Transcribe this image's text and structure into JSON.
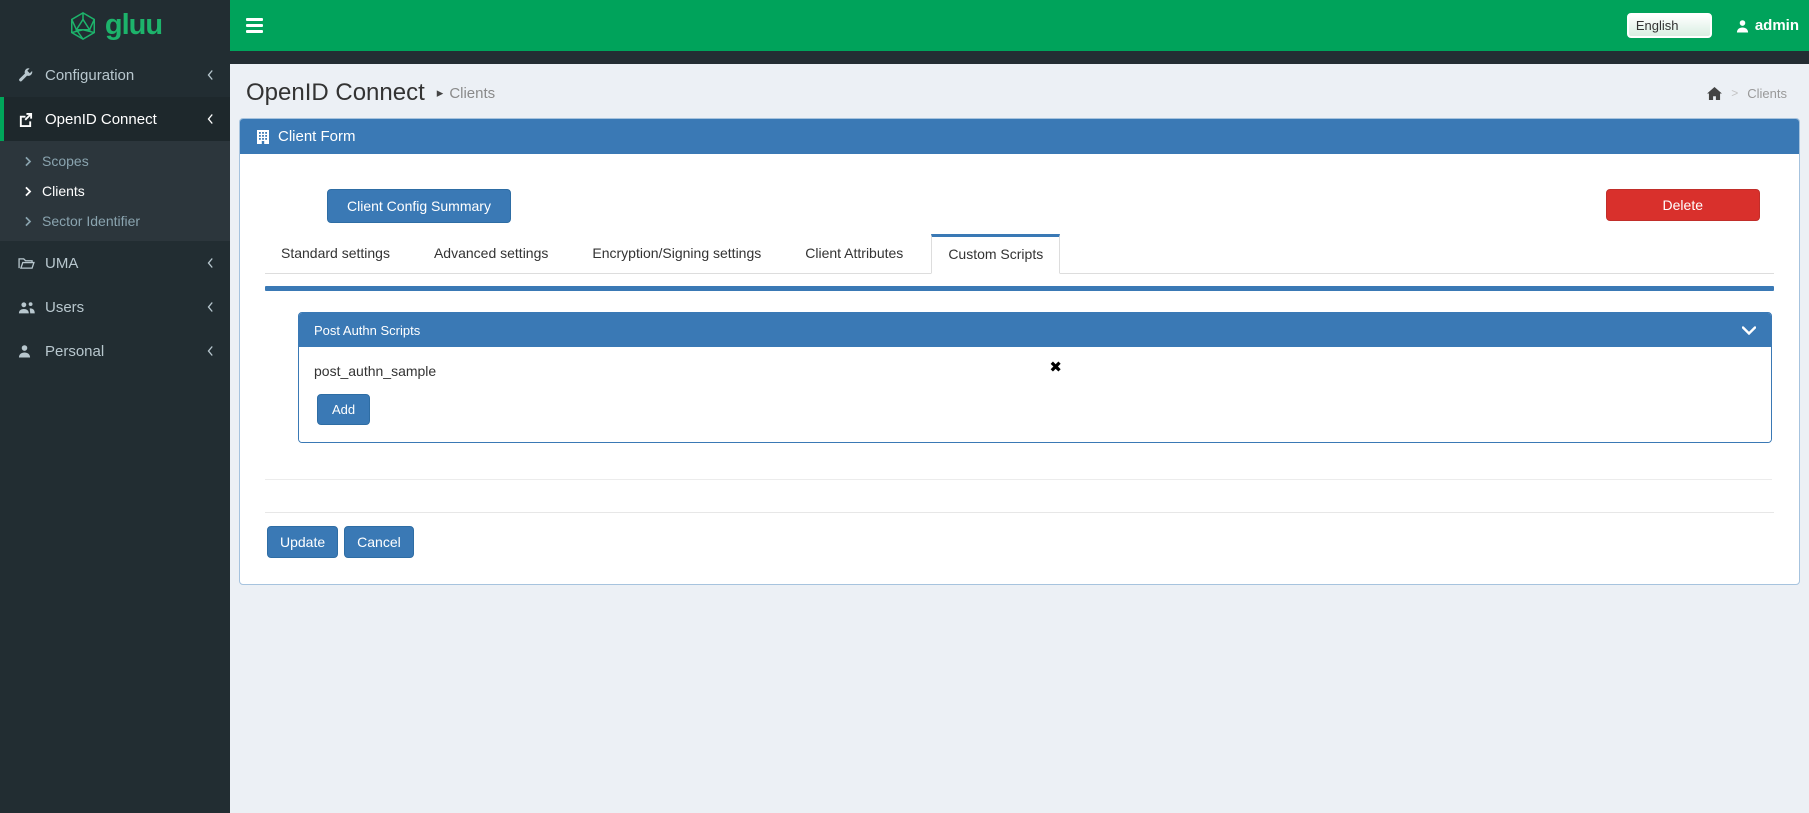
{
  "brand": {
    "name": "gluu"
  },
  "topbar": {
    "language": "English",
    "username": "admin"
  },
  "sidebar": {
    "items": [
      {
        "label": "Configuration",
        "icon": "wrench-icon"
      },
      {
        "label": "OpenID Connect",
        "icon": "external-link-icon",
        "active": true
      },
      {
        "label": "UMA",
        "icon": "folder-open-icon"
      },
      {
        "label": "Users",
        "icon": "users-icon"
      },
      {
        "label": "Personal",
        "icon": "user-icon"
      }
    ],
    "submenu": [
      {
        "label": "Scopes"
      },
      {
        "label": "Clients",
        "active": true
      },
      {
        "label": "Sector Identifier"
      }
    ]
  },
  "page_header": {
    "title": "OpenID Connect",
    "caret": "▸",
    "subtitle": "Clients"
  },
  "breadcrumb": {
    "separator": ">",
    "current": "Clients"
  },
  "box": {
    "title": "Client Form"
  },
  "toolbar": {
    "summary_label": "Client Config Summary",
    "delete_label": "Delete"
  },
  "tabs": [
    {
      "label": "Standard settings"
    },
    {
      "label": "Advanced settings"
    },
    {
      "label": "Encryption/Signing settings"
    },
    {
      "label": "Client Attributes"
    },
    {
      "label": "Custom Scripts",
      "active": true
    }
  ],
  "scripts_panel": {
    "title": "Post Authn Scripts",
    "items": [
      {
        "name": "post_authn_sample"
      }
    ],
    "add_label": "Add"
  },
  "footer": {
    "update_label": "Update",
    "cancel_label": "Cancel"
  },
  "icons": {
    "remove_glyph": "✖"
  },
  "colors": {
    "navbar_green": "#00a35b",
    "logo_green": "#1db36b",
    "active_green": "#00a65a",
    "primary_blue": "#3a79b5",
    "delete_red": "#d9302c",
    "sidebar_bg": "#222d32",
    "submenu_bg": "#2c363c",
    "content_bg": "#ecf0f5",
    "card_border": "#a6c3de"
  }
}
